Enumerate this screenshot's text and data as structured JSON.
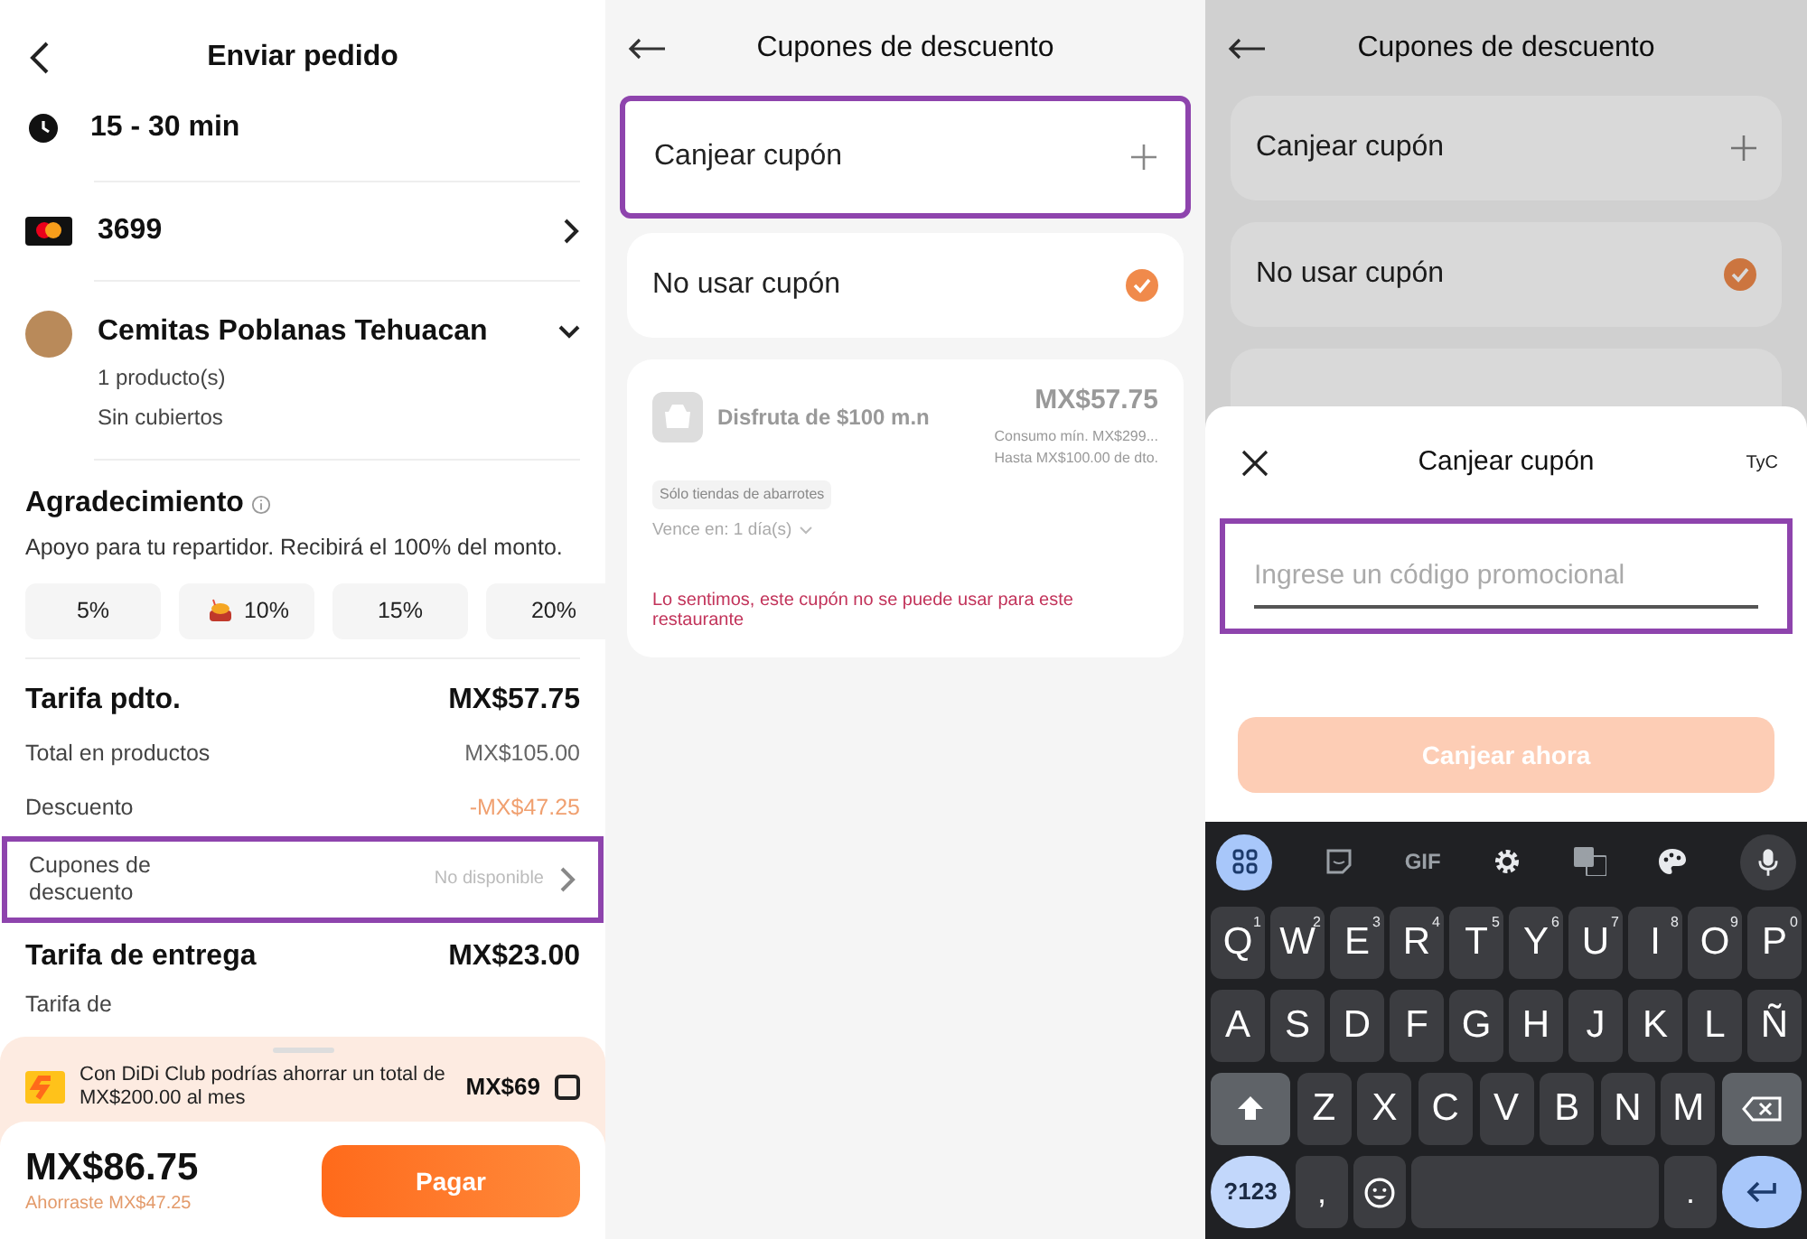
{
  "order_screen": {
    "title": "Enviar pedido",
    "delivery_time": "15 - 30 min",
    "card_number": "3699",
    "restaurant": {
      "name": "Cemitas Poblanas Tehuacan",
      "items": "1 producto(s)",
      "cutlery": "Sin cubiertos",
      "expanded": false
    },
    "tip": {
      "title": "Agradecimiento",
      "subtitle": "Apoyo para tu repartidor. Recibirá el 100% del monto.",
      "options": [
        {
          "label": "5%",
          "selected": false,
          "kind": "plain"
        },
        {
          "label": "10%",
          "selected": false,
          "kind": "emoji"
        },
        {
          "label": "15%",
          "selected": false,
          "kind": "plain"
        },
        {
          "label": "20%",
          "selected": false,
          "kind": "plain"
        }
      ]
    },
    "fees": [
      {
        "kind": "heading",
        "label": "Tarifa pdto.",
        "value": "MX$57.75"
      },
      {
        "kind": "line",
        "label": "Total en productos",
        "value": "MX$105.00"
      },
      {
        "kind": "discount",
        "label": "Descuento",
        "value": "-MX$47.25"
      },
      {
        "kind": "link",
        "label": "Cupones de descuento",
        "value": "No disponible",
        "highlighted": true
      },
      {
        "kind": "heading",
        "label": "Tarifa de entrega",
        "value": "MX$23.00"
      },
      {
        "kind": "cut",
        "label": "Tarifa de"
      }
    ],
    "club": {
      "text": "Con DiDi Club podrías ahorrar un total de MX$200.00 al mes",
      "price": "MX$69",
      "checked": false
    },
    "total": "MX$86.75",
    "savings": "Ahorraste MX$47.25",
    "pay_button": "Pagar"
  },
  "coupons_screen": {
    "title": "Cupones de descuento",
    "redeem": {
      "label": "Canjear cupón",
      "highlighted": true
    },
    "no_coupon": {
      "label": "No usar cupón",
      "checked": true
    },
    "coupon": {
      "title": "Disfruta de $100 m.n",
      "amount": "MX$57.75",
      "minimum": "Consumo mín. MX$299...",
      "cap": "Hasta MX$100.00 de dto.",
      "tag": "Sólo tiendas de abarrotes",
      "expiry": "Vence en: 1 día(s)",
      "error": "Lo sentimos, este cupón no se puede usar para este restaurante"
    }
  },
  "redeem_screen": {
    "title": "Cupones de descuento",
    "background_items": [
      {
        "label": "Canjear cupón",
        "kind": "add"
      },
      {
        "label": "No usar cupón",
        "kind": "check"
      }
    ],
    "sheet": {
      "title": "Canjear cupón",
      "terms": "TyC",
      "placeholder": "Ingrese un código promocional",
      "highlighted": true,
      "button": "Canjear ahora",
      "disabled": true
    },
    "keyboard": {
      "gif": "GIF",
      "rows": [
        [
          {
            "label": "Q",
            "hint": "1"
          },
          {
            "label": "W",
            "hint": "2"
          },
          {
            "label": "E",
            "hint": "3"
          },
          {
            "label": "R",
            "hint": "4"
          },
          {
            "label": "T",
            "hint": "5"
          },
          {
            "label": "Y",
            "hint": "6"
          },
          {
            "label": "U",
            "hint": "7"
          },
          {
            "label": "I",
            "hint": "8"
          },
          {
            "label": "O",
            "hint": "9"
          },
          {
            "label": "P",
            "hint": "0"
          }
        ],
        [
          {
            "label": "A"
          },
          {
            "label": "S"
          },
          {
            "label": "D"
          },
          {
            "label": "F"
          },
          {
            "label": "G"
          },
          {
            "label": "H"
          },
          {
            "label": "J"
          },
          {
            "label": "K"
          },
          {
            "label": "L"
          },
          {
            "label": "Ñ"
          }
        ],
        [
          {
            "label": "Z"
          },
          {
            "label": "X"
          },
          {
            "label": "C"
          },
          {
            "label": "V"
          },
          {
            "label": "B"
          },
          {
            "label": "N"
          },
          {
            "label": "M"
          }
        ]
      ],
      "symbols": "?123",
      "comma": ",",
      "period": "."
    }
  }
}
